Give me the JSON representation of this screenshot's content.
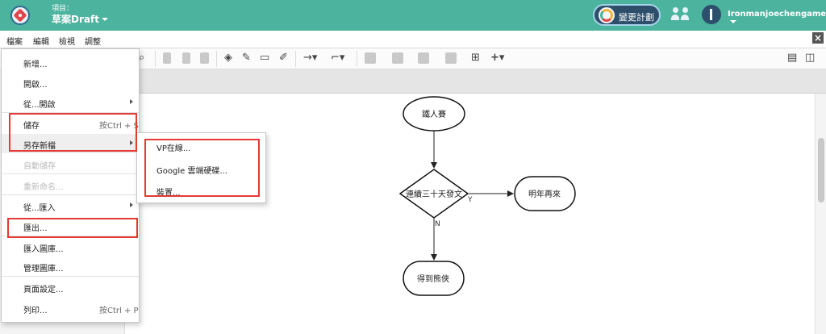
{
  "header": {
    "project_label": "項目：",
    "project_name": "草案Draft",
    "plan_button": "變更計劃",
    "username": "Ironmanjoechengame"
  },
  "menubar": {
    "items": [
      "檔案",
      "編輯",
      "檢視",
      "調整"
    ]
  },
  "file_menu": {
    "items": [
      {
        "label": "新增..."
      },
      {
        "label": "開啟..."
      },
      {
        "label": "從...開啟"
      },
      {
        "label": "儲存",
        "shortcut": "按Ctrl + S"
      },
      {
        "label": "另存新檔"
      },
      {
        "label": "自動儲存"
      },
      {
        "label": "重新命名..."
      },
      {
        "label": "從...匯入"
      },
      {
        "label": "匯出..."
      },
      {
        "label": "匯入圖庫..."
      },
      {
        "label": "管理圖庫..."
      },
      {
        "label": "頁面設定..."
      },
      {
        "label": "列印...",
        "shortcut": "按Ctrl + P"
      }
    ]
  },
  "save_as_submenu": {
    "items": [
      "VP在線...",
      "Google 雲端硬碟...",
      "裝置..."
    ]
  },
  "diagram": {
    "start": "鐵人賽",
    "decision": "連續三十天發文",
    "yes_label": "Y",
    "no_label": "N",
    "yes_target": "明年再來",
    "no_target": "得到熊俠"
  },
  "colors": {
    "header_bg": "#4bb39e",
    "highlight_box": "#e53935"
  }
}
